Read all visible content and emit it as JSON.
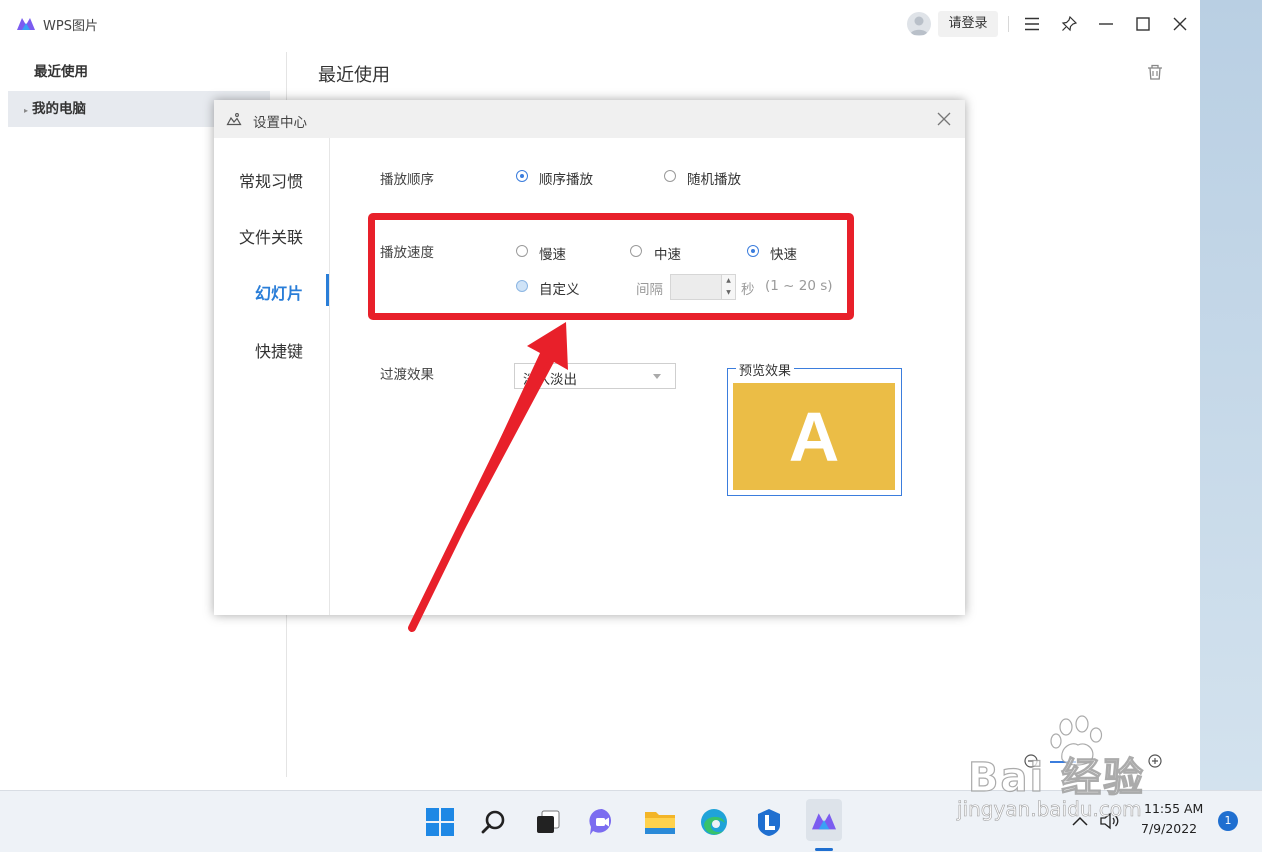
{
  "app": {
    "title": "WPS图片",
    "login_label": "请登录",
    "main_title": "最近使用"
  },
  "sidebar": {
    "items": [
      {
        "label": "最近使用"
      },
      {
        "label": "我的电脑"
      }
    ]
  },
  "dialog": {
    "title": "设置中心",
    "nav": [
      {
        "label": "常规习惯"
      },
      {
        "label": "文件关联"
      },
      {
        "label": "幻灯片"
      },
      {
        "label": "快捷键"
      }
    ],
    "play_order": {
      "label": "播放顺序",
      "options": [
        {
          "label": "顺序播放",
          "checked": true
        },
        {
          "label": "随机播放",
          "checked": false
        }
      ]
    },
    "play_speed": {
      "label": "播放速度",
      "options": [
        {
          "label": "慢速",
          "checked": false
        },
        {
          "label": "中速",
          "checked": false
        },
        {
          "label": "快速",
          "checked": true
        },
        {
          "label": "自定义",
          "checked": false
        }
      ],
      "interval_label": "间隔",
      "interval_value": "",
      "unit_label": "秒",
      "range_label": "(1 ~ 20 s)"
    },
    "transition": {
      "label": "过渡效果",
      "value": "淡入淡出",
      "preview_label": "预览效果",
      "preview_letter": "A"
    }
  },
  "taskbar": {
    "time": "11:55 AM",
    "date": "7/9/2022",
    "notification_count": "1"
  },
  "watermark": {
    "logo_text": "Bai  经验",
    "url": "jingyan.baidu.com"
  },
  "colors": {
    "accent": "#2a7ed8",
    "annotation_red": "#e8202a",
    "preview_bg": "#ebbd46"
  }
}
